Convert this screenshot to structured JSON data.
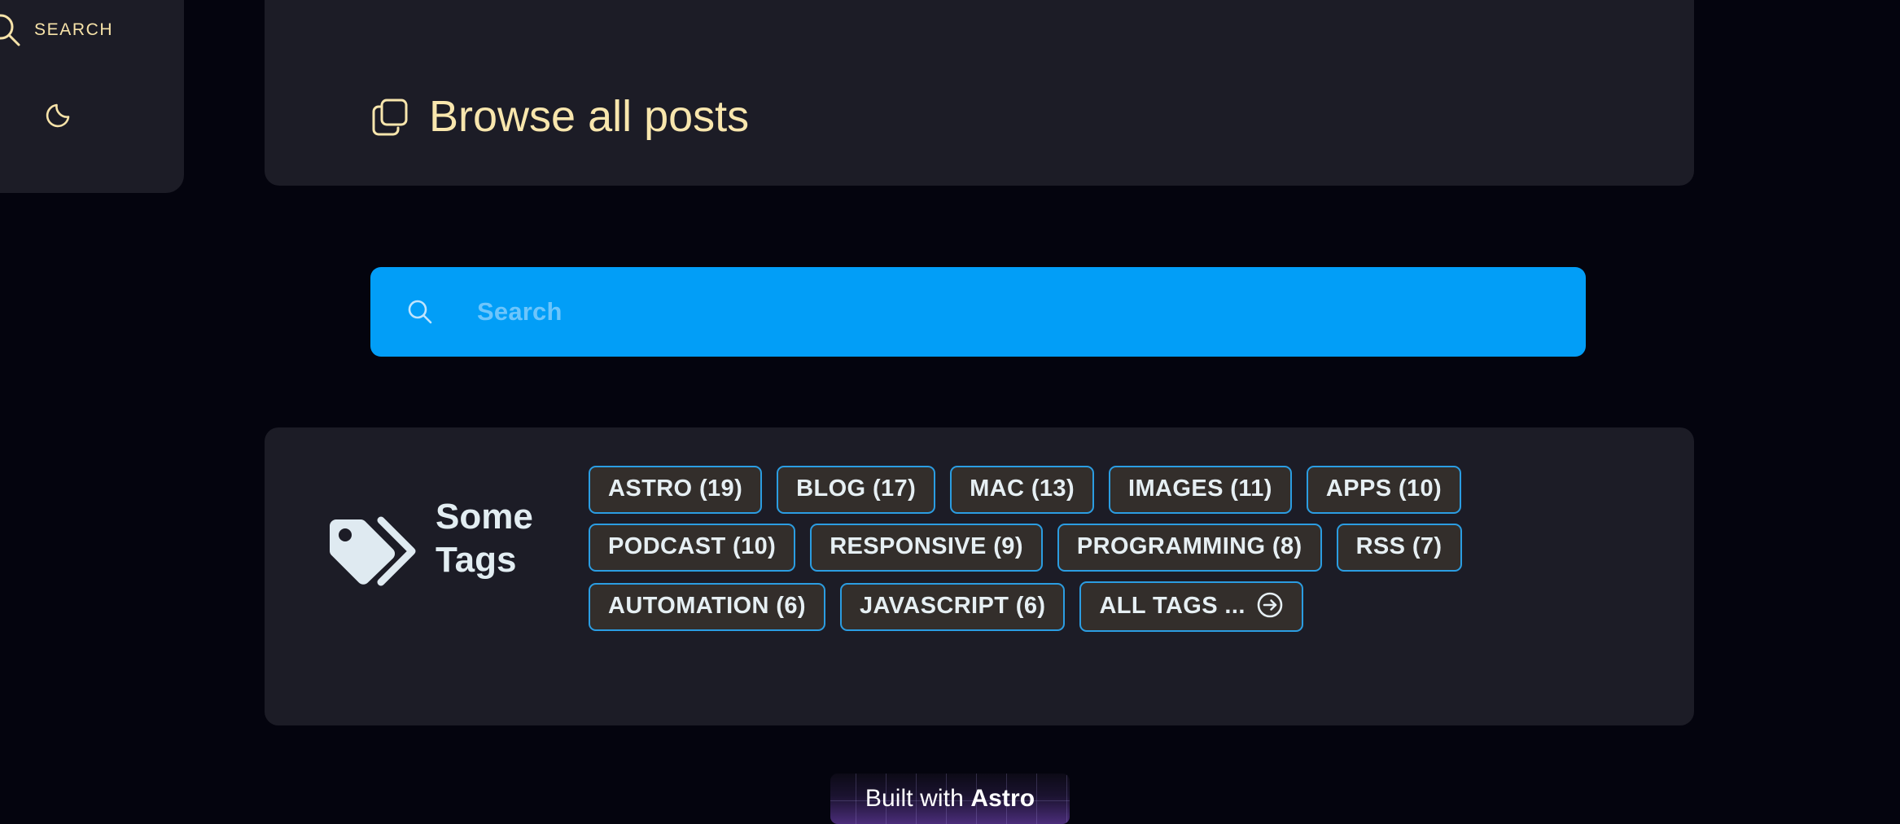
{
  "theme": {
    "page_background": "#04040e",
    "panel_background": "#1c1c26",
    "accent_cream": "#f8e6ad",
    "accent_blue": "#029ef7",
    "tag_border": "#2b9de2",
    "tag_fill": "#332e2b",
    "tag_text": "#e6eff3"
  },
  "sidebar": {
    "search_label": "SEARCH",
    "search_icon": "search-icon",
    "theme_toggle_icon": "moon-icon"
  },
  "header": {
    "title": "Browse all posts",
    "title_icon": "copy-squares-icon"
  },
  "search": {
    "placeholder": "Search",
    "value": "",
    "icon": "search-icon"
  },
  "tags_section": {
    "heading": "Some Tags",
    "icon": "tags-icon",
    "rows": [
      [
        {
          "label": "ASTRO (19)"
        },
        {
          "label": "BLOG (17)"
        },
        {
          "label": "MAC (13)"
        },
        {
          "label": "IMAGES (11)"
        },
        {
          "label": "APPS (10)"
        }
      ],
      [
        {
          "label": "PODCAST (10)"
        },
        {
          "label": "RESPONSIVE (9)"
        },
        {
          "label": "PROGRAMMING (8)"
        },
        {
          "label": "RSS (7)"
        }
      ],
      [
        {
          "label": "AUTOMATION (6)"
        },
        {
          "label": "JAVASCRIPT (6)"
        },
        {
          "label": "ALL TAGS ...",
          "icon": "arrow-right-circle-icon"
        }
      ]
    ]
  },
  "footer": {
    "badge_prefix": "Built with ",
    "badge_brand": "Astro"
  }
}
